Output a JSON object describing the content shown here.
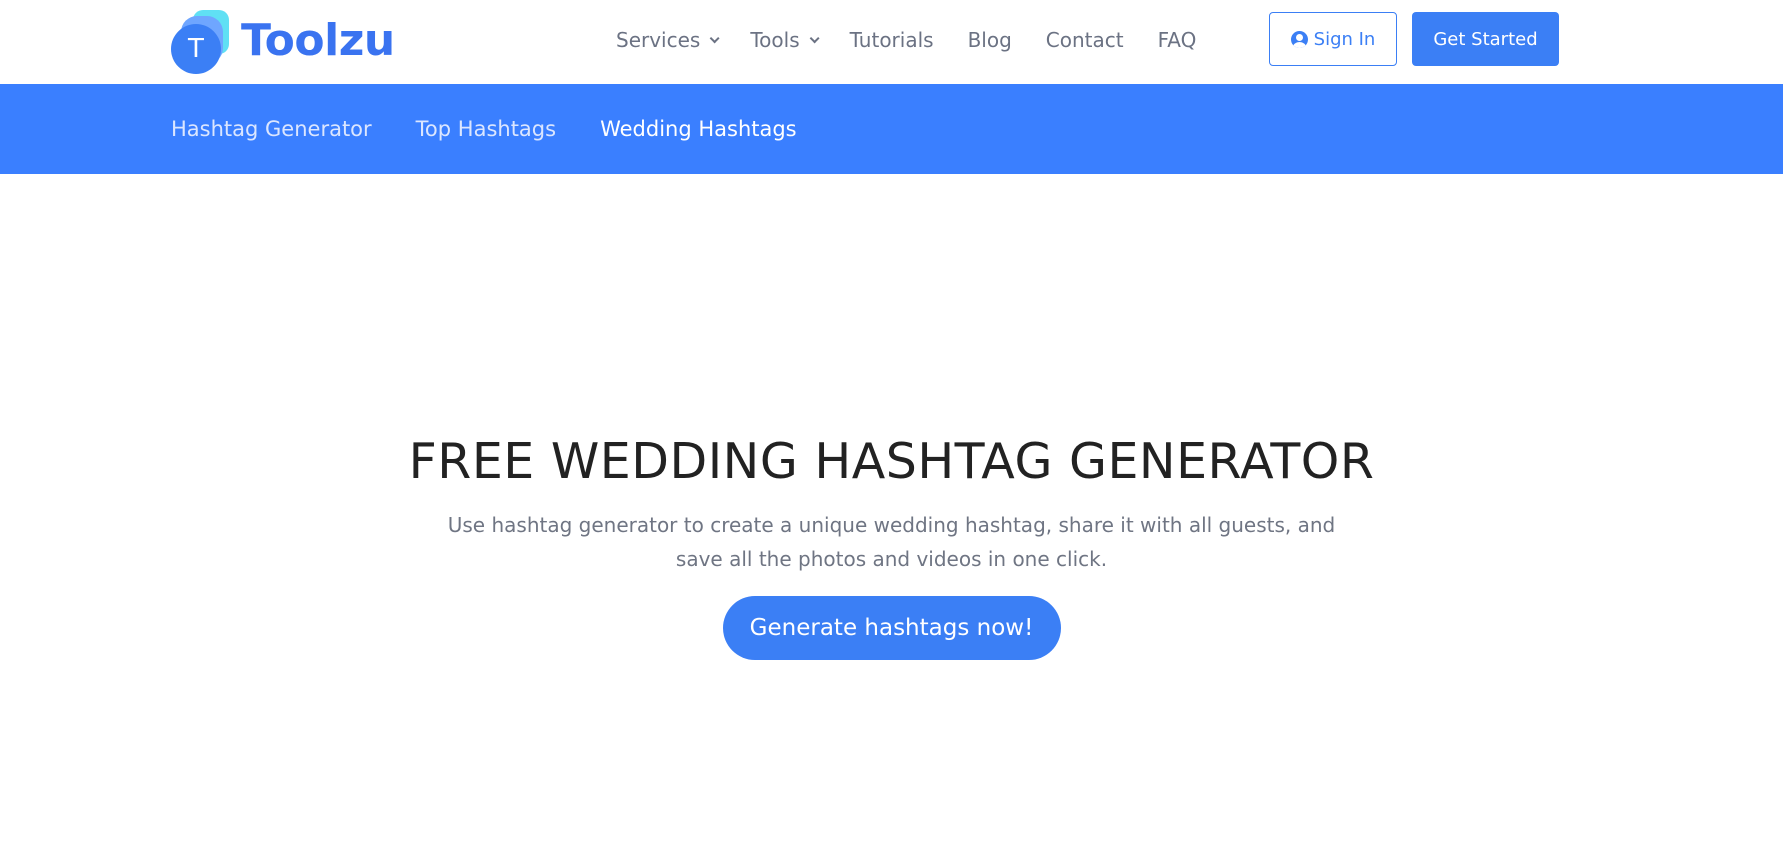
{
  "brand": {
    "logo_letter": "T",
    "name": "Toolzu",
    "color": "#3a73f0"
  },
  "main_nav": [
    {
      "label": "Services",
      "dropdown": true
    },
    {
      "label": "Tools",
      "dropdown": true
    },
    {
      "label": "Tutorials",
      "dropdown": false
    },
    {
      "label": "Blog",
      "dropdown": false
    },
    {
      "label": "Contact",
      "dropdown": false
    },
    {
      "label": "FAQ",
      "dropdown": false
    }
  ],
  "auth": {
    "sign_in": "Sign In",
    "get_started": "Get Started"
  },
  "sub_nav": [
    {
      "label": "Hashtag Generator",
      "active": false
    },
    {
      "label": "Top Hashtags",
      "active": false
    },
    {
      "label": "Wedding Hashtags",
      "active": true
    }
  ],
  "hero": {
    "title": "FREE WEDDING HASHTAG GENERATOR",
    "description": "Use hashtag generator to create a unique wedding hashtag, share it with all guests, and save all the photos and videos in one click.",
    "cta": "Generate hashtags now!"
  },
  "colors": {
    "accent": "#3b7ff5",
    "subnav_bg": "#3a7fff"
  }
}
